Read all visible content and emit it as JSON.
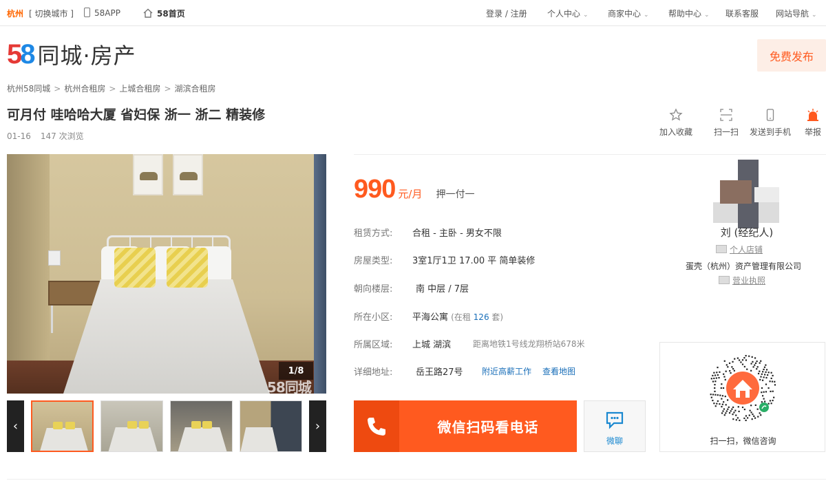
{
  "topbar": {
    "city": "杭州",
    "switch_city": "[ 切换城市 ]",
    "app": "58APP",
    "home": "58首页",
    "login": "登录 / 注册",
    "menus": [
      "个人中心",
      "商家中心",
      "帮助中心"
    ],
    "service": "联系客服",
    "sitenav": "网站导航"
  },
  "header": {
    "logo_text": "同城·房产",
    "publish": "免费发布"
  },
  "breadcrumb": [
    "杭州58同城",
    "杭州合租房",
    "上城合租房",
    "湖滨合租房"
  ],
  "listing": {
    "title": "可月付 哇哈哈大厦 省妇保 浙一 浙二 精装修",
    "date": "01-16",
    "views": "147 次浏览"
  },
  "actions": [
    {
      "label": "加入收藏",
      "icon": "star-icon"
    },
    {
      "label": "扫一扫",
      "icon": "scan-icon"
    },
    {
      "label": "发送到手机",
      "icon": "mobile-icon"
    },
    {
      "label": "举报",
      "icon": "alarm-icon"
    }
  ],
  "gallery": {
    "counter": "1/8",
    "watermark": "58同城",
    "prev": "‹",
    "next": "›"
  },
  "price": {
    "amount": "990",
    "unit": "元/月",
    "payment": "押一付一"
  },
  "info": {
    "rent_type": {
      "label": "租赁方式:",
      "value": "合租 - 主卧 - 男女不限"
    },
    "house_type": {
      "label": "房屋类型:",
      "value": "3室1厅1卫  17.00 平  简单装修"
    },
    "orientation": {
      "label": "朝向楼层:",
      "value": "南  中层 / 7层"
    },
    "community": {
      "label": "所在小区:",
      "value": "平海公寓",
      "extra_prefix": "(在租",
      "extra_count": "126",
      "extra_suffix": "套)"
    },
    "district": {
      "label": "所属区域:",
      "value": "上城   湖滨",
      "subway": "距离地铁1号线龙翔桥站678米"
    },
    "address": {
      "label": "详细地址:",
      "value": "岳王路27号",
      "jobs_link": "附近高薪工作",
      "map_link": "查看地图"
    }
  },
  "contact": {
    "call_label": "微信扫码看电话",
    "chat_label": "微聊"
  },
  "agent": {
    "name": "刘    (经纪人)",
    "shop": "个人店铺",
    "company": "蛋壳（杭州）资产管理有限公司",
    "license": "营业执照",
    "qr_caption": "扫一扫，微信咨询"
  },
  "colors": {
    "accent": "#ff5a1f",
    "link": "#1a6fb9"
  }
}
